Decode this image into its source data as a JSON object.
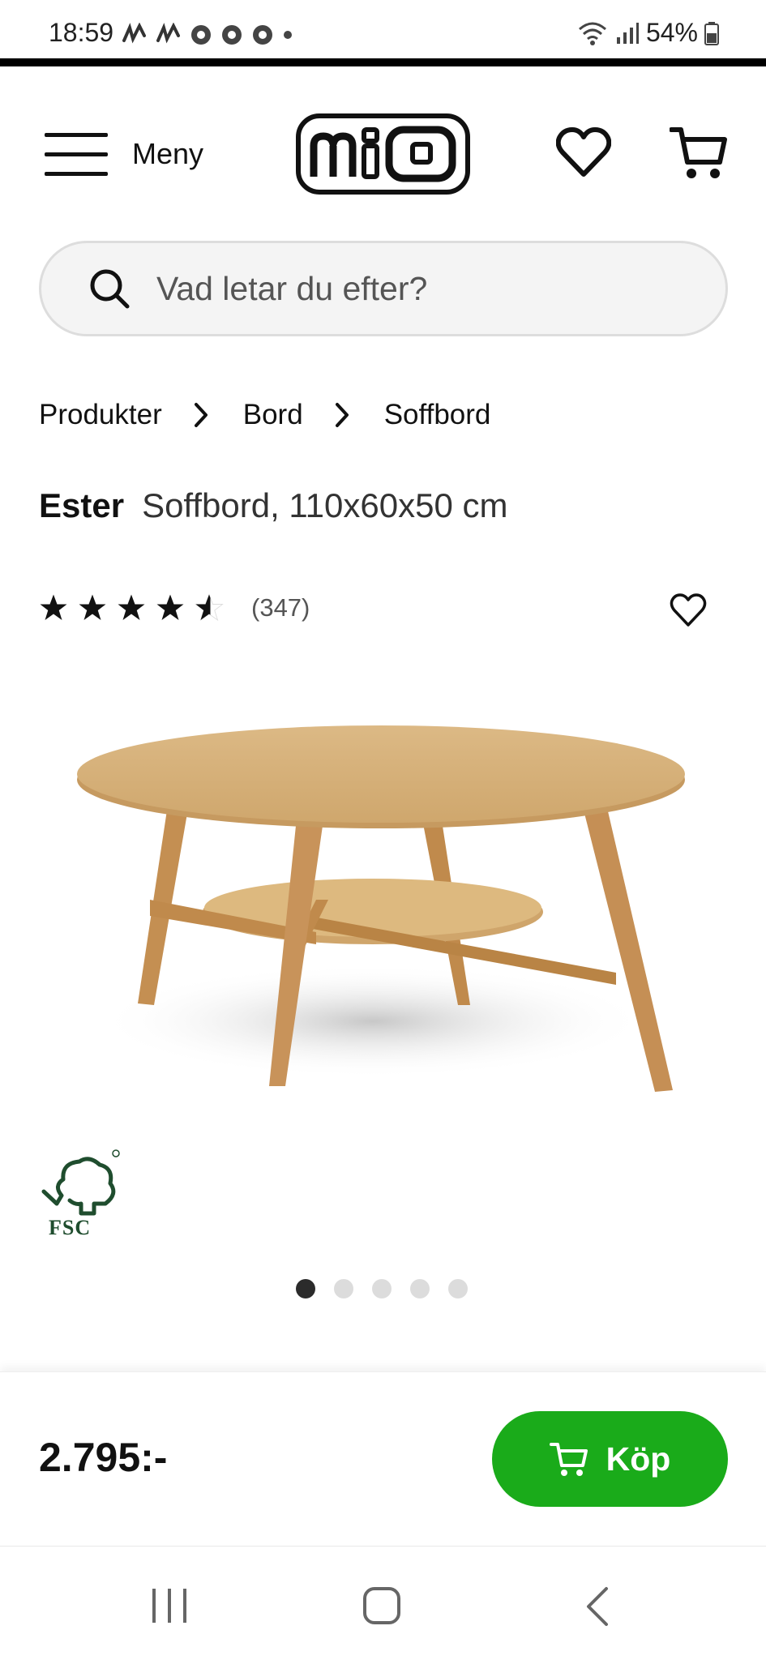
{
  "status_bar": {
    "time": "18:59",
    "battery": "54%"
  },
  "header": {
    "menu_label": "Meny",
    "logo_text": "MIO"
  },
  "search": {
    "placeholder": "Vad letar du efter?"
  },
  "breadcrumb": [
    "Produkter",
    "Bord",
    "Soffbord"
  ],
  "product": {
    "brand": "Ester",
    "description": "Soffbord, 110x60x50 cm",
    "rating": 4.5,
    "review_count": "(347)",
    "certification": "FSC",
    "image_count": 5,
    "active_image": 1,
    "price": "2.795:-"
  },
  "buy_button": {
    "label": "Köp"
  },
  "colors": {
    "accent": "#1aab1a",
    "wood": "#d3ad75"
  }
}
